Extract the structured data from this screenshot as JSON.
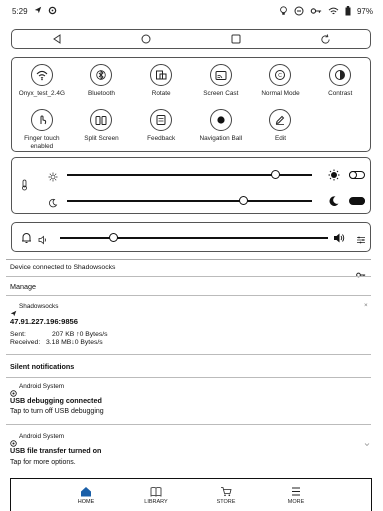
{
  "status_bar": {
    "time": "5:29",
    "battery": "97%"
  },
  "quick_settings": [
    {
      "label": "Onyx_test_2.4G",
      "icon": "wifi-icon"
    },
    {
      "label": "Bluetooth",
      "icon": "bluetooth-icon"
    },
    {
      "label": "Rotate",
      "icon": "rotate-icon"
    },
    {
      "label": "Screen Cast",
      "icon": "screen-cast-icon"
    },
    {
      "label": "Normal Mode",
      "icon": "refresh-mode-icon"
    },
    {
      "label": "Contrast",
      "icon": "contrast-icon"
    },
    {
      "label": "Finger touch enabled",
      "icon": "finger-touch-icon"
    },
    {
      "label": "Split Screen",
      "icon": "split-screen-icon"
    },
    {
      "label": "Feedback",
      "icon": "feedback-icon"
    },
    {
      "label": "Navigation Ball",
      "icon": "navigation-ball-icon"
    },
    {
      "label": "Edit",
      "icon": "edit-icon"
    }
  ],
  "sliders": {
    "cold_light_level": 0.85,
    "warm_light_level": 0.72,
    "cold_toggle": "off",
    "warm_toggle": "on",
    "volume_level": 0.2
  },
  "notifications": {
    "vpn_bar": "Device connected to Shadowsocks",
    "manage": "Manage",
    "shadowsocks": {
      "app": "Shadowsocks",
      "ip": "47.91.227.196:9856",
      "sent_label": "Sent:",
      "sent_value": "207 KB ↑0 Bytes/s",
      "received_label": "Received:",
      "received_value": "3.18 MB↓0 Bytes/s",
      "close": "×"
    },
    "silent_header": "Silent notifications",
    "usb_debug": {
      "app": "Android System",
      "title": "USB debugging connected",
      "text": "Tap to turn off USB debugging"
    },
    "usb_transfer": {
      "app": "Android System",
      "title": "USB file transfer turned on",
      "text": "Tap for more options."
    }
  },
  "bottom_nav": [
    {
      "label": "HOME",
      "icon": "home-icon"
    },
    {
      "label": "LIBRARY",
      "icon": "library-icon"
    },
    {
      "label": "STORE",
      "icon": "store-icon"
    },
    {
      "label": "MORE",
      "icon": "more-icon"
    }
  ]
}
